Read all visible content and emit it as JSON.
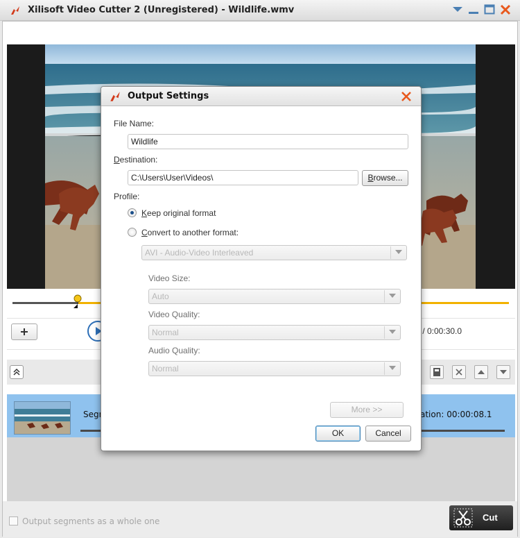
{
  "window": {
    "title": "Xilisoft Video Cutter 2 (Unregistered) - Wildlife.wmv"
  },
  "player": {
    "time_readout": ") / 0:00:30.0"
  },
  "segments": {
    "items": [
      {
        "name": "Segm",
        "duration": "ation: 00:00:08.1"
      }
    ]
  },
  "bottom": {
    "whole_label": "Output segments as a whole one",
    "cut_label": "Cut"
  },
  "dialog": {
    "title": "Output Settings",
    "file_name_label": "File Name:",
    "file_name_value": "Wildlife",
    "destination_label_first": "D",
    "destination_label_rest": "estination:",
    "destination_value": "C:\\Users\\User\\Videos\\",
    "browse_label_first": "B",
    "browse_label_rest": "rowse...",
    "profile_label": "Profile:",
    "keep_label_first": "K",
    "keep_label_rest": "eep original format",
    "convert_label_first": "C",
    "convert_label_rest": "onvert to another format:",
    "format_value": "AVI - Audio-Video Interleaved",
    "video_size_label": "Video Size:",
    "video_size_value": "Auto",
    "video_quality_label": "Video Quality:",
    "video_quality_value": "Normal",
    "audio_quality_label": "Audio Quality:",
    "audio_quality_value": "Normal",
    "more_label": "More >>",
    "ok_label": "OK",
    "cancel_label": "Cancel",
    "profile_selected": "keep"
  },
  "colors": {
    "accent_blue": "#2d6fb7",
    "timeline_fill": "#f2b100",
    "segment_selected": "#8fc2ee",
    "close_x": "#e8581c"
  },
  "icons": [
    "app-logo-icon",
    "window-menu-icon",
    "minimize-icon",
    "maximize-icon",
    "close-icon",
    "play-icon",
    "collapse-icon",
    "export-icon",
    "delete-icon",
    "move-up-icon",
    "move-down-icon",
    "scissors-icon"
  ]
}
